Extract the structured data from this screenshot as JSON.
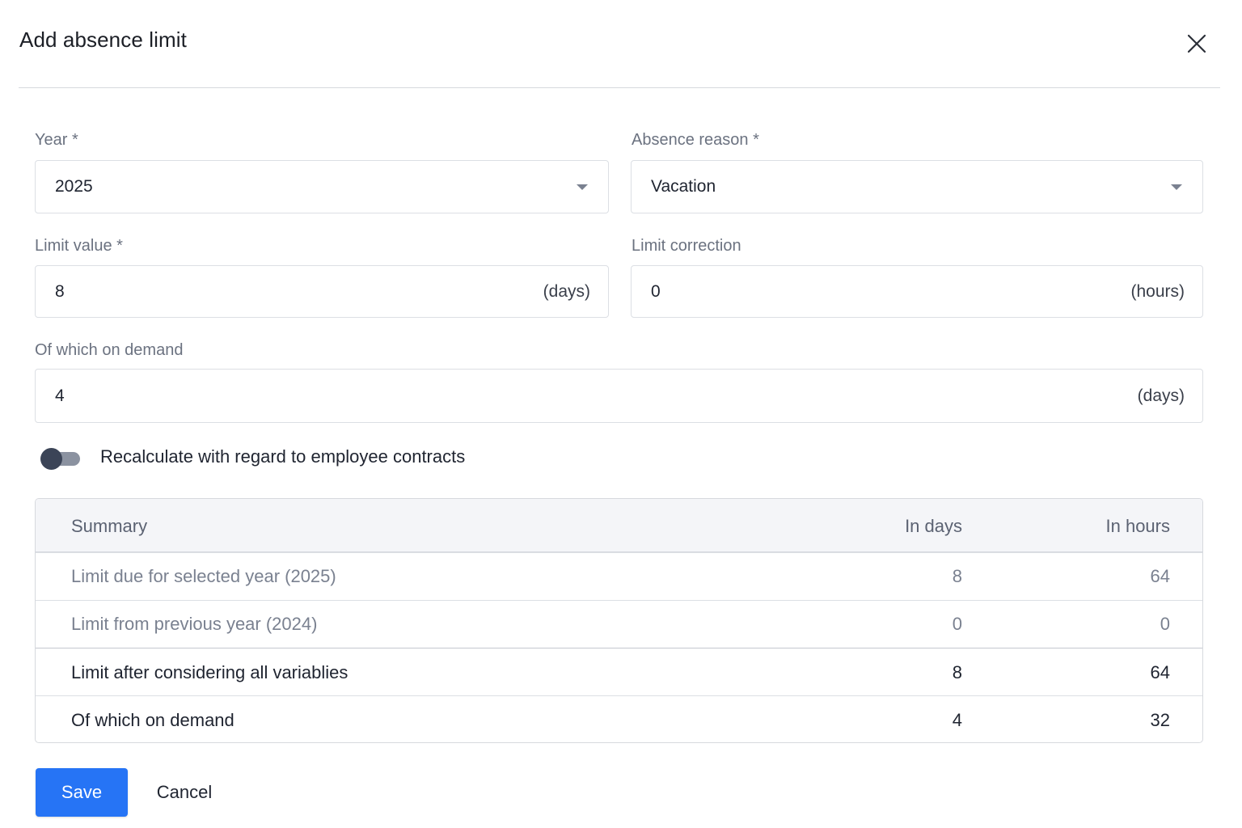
{
  "dialog": {
    "title": "Add absence limit",
    "close_icon": "close-icon"
  },
  "form": {
    "year": {
      "label": "Year *",
      "value": "2025",
      "icon": "caret-down-icon"
    },
    "absence_reason": {
      "label": "Absence reason *",
      "value": "Vacation",
      "icon": "caret-down-icon"
    },
    "limit_value": {
      "label": "Limit value *",
      "value": "8",
      "unit": "(days)"
    },
    "limit_correction": {
      "label": "Limit correction",
      "value": "0",
      "unit": "(hours)"
    },
    "on_demand": {
      "label": "Of which on demand",
      "value": "4",
      "unit": "(days)"
    },
    "recalculate": {
      "label": "Recalculate with regard to employee contracts",
      "enabled": false
    }
  },
  "summary": {
    "headers": {
      "name": "Summary",
      "days": "In days",
      "hours": "In hours"
    },
    "rows": [
      {
        "name": "Limit due for selected year (2025)",
        "days": "8",
        "hours": "64",
        "emphasis": false
      },
      {
        "name": "Limit from previous year (2024)",
        "days": "0",
        "hours": "0",
        "emphasis": false
      },
      {
        "name": "Limit after considering all variablies",
        "days": "8",
        "hours": "64",
        "emphasis": true
      },
      {
        "name": "Of which on demand",
        "days": "4",
        "hours": "32",
        "emphasis": true
      }
    ]
  },
  "actions": {
    "save_label": "Save",
    "cancel_label": "Cancel"
  },
  "colors": {
    "primary": "#2674f5",
    "toggle_knob": "#3b4457",
    "toggle_track": "#8b92a0"
  }
}
